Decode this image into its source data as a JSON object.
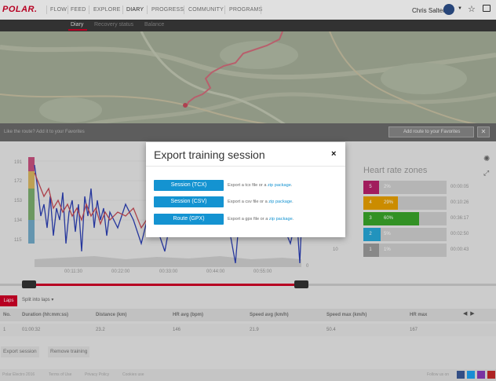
{
  "nav": {
    "logo": "POLAR.",
    "items": [
      {
        "label": "FLOW"
      },
      {
        "label": "FEED"
      },
      {
        "label": "EXPLORE"
      },
      {
        "label": "DIARY"
      },
      {
        "label": "PROGRESS"
      },
      {
        "label": "COMMUNITY"
      },
      {
        "label": "PROGRAMS"
      }
    ],
    "user_name": "Chris Salter"
  },
  "subnav": {
    "items": [
      {
        "label": "Diary"
      },
      {
        "label": "Recovery status"
      },
      {
        "label": "Balance"
      }
    ]
  },
  "map": {
    "caption": "Like the route?  Add it to your Favorites",
    "fav_button": "Add route to your Favorites",
    "close": "✕"
  },
  "chart": {
    "y_ticks": [
      "191",
      "172",
      "153",
      "134",
      "115"
    ],
    "y_right_ticks": [
      "10",
      "0"
    ],
    "x_ticks": [
      "00:11:30",
      "00:22:00",
      "00:33:00",
      "00:44:00",
      "00:55:00"
    ]
  },
  "hr_zones": {
    "title": "Heart rate zones",
    "rows": [
      {
        "zone": "5",
        "pct": "2%",
        "time": "00:00:05",
        "color": "#b8206a",
        "fill": 0.02
      },
      {
        "zone": "4",
        "pct": "29%",
        "time": "00:10:26",
        "color": "#e8a000",
        "fill": 0.29
      },
      {
        "zone": "3",
        "pct": "60%",
        "time": "00:36:17",
        "color": "#3aa629",
        "fill": 0.6
      },
      {
        "zone": "2",
        "pct": "5%",
        "time": "00:02:50",
        "color": "#27a8d8",
        "fill": 0.05
      },
      {
        "zone": "1",
        "pct": "1%",
        "time": "00:00:43",
        "color": "#9b9b9b",
        "fill": 0.01
      }
    ]
  },
  "laps": {
    "tab_laps": "Laps",
    "tab_split": "Split into laps",
    "headers": [
      "No.",
      "Duration (hh:mm:ss)",
      "Distance (km)",
      "HR avg (bpm)",
      "Speed avg (km/h)",
      "Speed max (km/h)",
      "HR max"
    ],
    "row": [
      "1",
      "01:00:32",
      "23.2",
      "146",
      "21.9",
      "50.4",
      "167"
    ]
  },
  "actions": {
    "export": "Export session",
    "remove": "Remove training"
  },
  "footer": {
    "items": [
      "Polar Electro 2016",
      "Terms of Use",
      "Privacy Policy",
      "Cookies use",
      "Follow us on"
    ]
  },
  "modal": {
    "title": "Export training session",
    "close": "×",
    "rows": [
      {
        "button": "Session (TCX)",
        "text": "Export a tcx file or a ",
        "link": "zip package",
        "tail": "."
      },
      {
        "button": "Session (CSV)",
        "text": "Export a csv file or a ",
        "link": "zip package",
        "tail": "."
      },
      {
        "button": "Route (GPX)",
        "text": "Export a gpx file or a ",
        "link": "zip package",
        "tail": "."
      }
    ]
  }
}
